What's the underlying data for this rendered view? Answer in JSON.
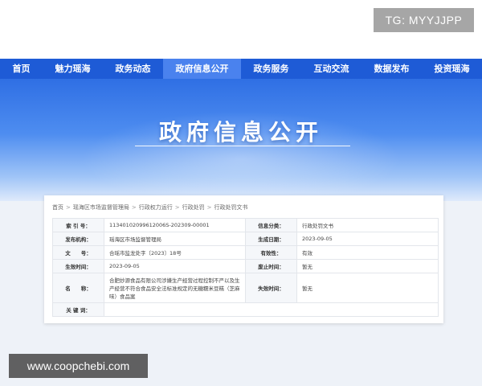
{
  "tag": "TG: MYYJJPP",
  "nav": {
    "items": [
      "首页",
      "魅力瑶海",
      "政务动态",
      "政府信息公开",
      "政务服务",
      "互动交流",
      "数据发布",
      "投资瑶海"
    ],
    "active": "政府信息公开"
  },
  "banner": {
    "title": "政府信息公开"
  },
  "breadcrumb": [
    "首页",
    "瑶海区市场监督管理局",
    "行政权力运行",
    "行政处罚",
    "行政处罚文书"
  ],
  "info": {
    "index_label": "索 引 号：",
    "index_value": "11340102099612006S-202309-00001",
    "category_label": "信息分类：",
    "category_value": "行政处罚文书",
    "publisher_label": "发布机构：",
    "publisher_value": "瑶海区市场监督管理局",
    "created_label": "生成日期：",
    "created_value": "2023-09-05",
    "docno_label": "文　　号：",
    "docno_value": "合瑶市监龙处字〔2023〕18号",
    "valid_label": "有效性：",
    "valid_value": "有效",
    "effective_label": "生效时间：",
    "effective_value": "2023-09-05",
    "abolish_label": "废止时间：",
    "abolish_value": "暂无",
    "name_label": "名　　称：",
    "name_value": "合肥妙源食品有限公司涉嫌生产经营过程控制不严以及生产经营不符合食品安全法标准规定的无糖糯米豆糕（芝麻味）食品案",
    "expire_label": "失效时间：",
    "expire_value": "暂无",
    "keywords_label": "关 键 词：",
    "keywords_value": ""
  },
  "watermark": "www.coopchebi.com"
}
